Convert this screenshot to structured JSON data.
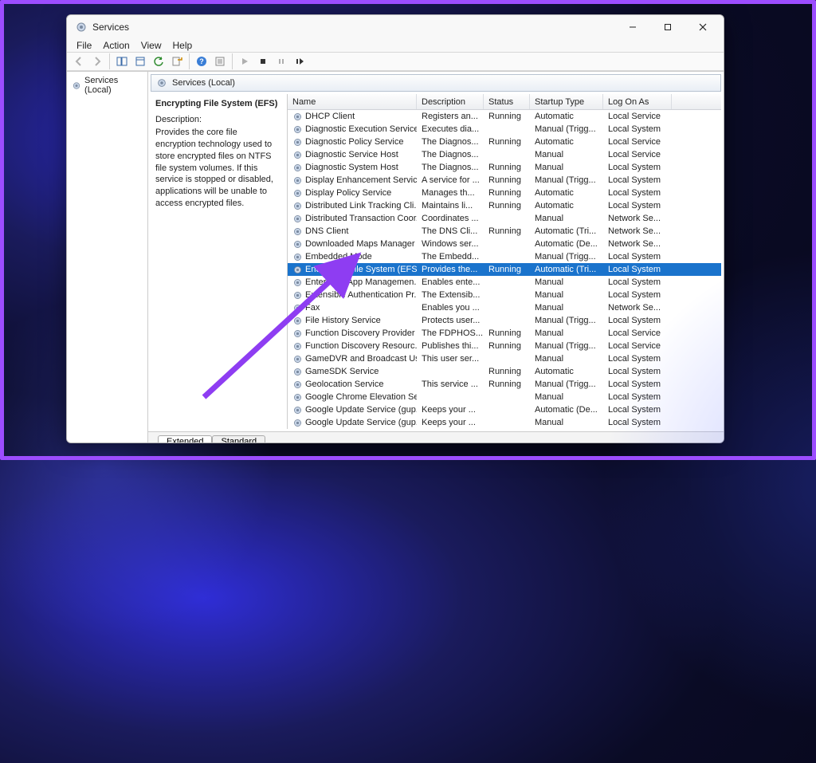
{
  "window": {
    "title": "Services"
  },
  "menu": [
    "File",
    "Action",
    "View",
    "Help"
  ],
  "tree_root": "Services (Local)",
  "header_label": "Services (Local)",
  "detail": {
    "name": "Encrypting File System (EFS)",
    "label": "Description:",
    "description": "Provides the core file encryption technology used to store encrypted files on NTFS file system volumes. If this service is stopped or disabled, applications will be unable to access encrypted files."
  },
  "columns": {
    "name": "Name",
    "description": "Description",
    "status": "Status",
    "startup": "Startup Type",
    "logon": "Log On As"
  },
  "services": [
    {
      "name": "DHCP Client",
      "desc": "Registers an...",
      "status": "Running",
      "startup": "Automatic",
      "logon": "Local Service"
    },
    {
      "name": "Diagnostic Execution Service",
      "desc": "Executes dia...",
      "status": "",
      "startup": "Manual (Trigg...",
      "logon": "Local System"
    },
    {
      "name": "Diagnostic Policy Service",
      "desc": "The Diagnos...",
      "status": "Running",
      "startup": "Automatic",
      "logon": "Local Service"
    },
    {
      "name": "Diagnostic Service Host",
      "desc": "The Diagnos...",
      "status": "",
      "startup": "Manual",
      "logon": "Local Service"
    },
    {
      "name": "Diagnostic System Host",
      "desc": "The Diagnos...",
      "status": "Running",
      "startup": "Manual",
      "logon": "Local System"
    },
    {
      "name": "Display Enhancement Service",
      "desc": "A service for ...",
      "status": "Running",
      "startup": "Manual (Trigg...",
      "logon": "Local System"
    },
    {
      "name": "Display Policy Service",
      "desc": "Manages th...",
      "status": "Running",
      "startup": "Automatic",
      "logon": "Local System"
    },
    {
      "name": "Distributed Link Tracking Cli...",
      "desc": "Maintains li...",
      "status": "Running",
      "startup": "Automatic",
      "logon": "Local System"
    },
    {
      "name": "Distributed Transaction Coor...",
      "desc": "Coordinates ...",
      "status": "",
      "startup": "Manual",
      "logon": "Network Se..."
    },
    {
      "name": "DNS Client",
      "desc": "The DNS Cli...",
      "status": "Running",
      "startup": "Automatic (Tri...",
      "logon": "Network Se..."
    },
    {
      "name": "Downloaded Maps Manager",
      "desc": "Windows ser...",
      "status": "",
      "startup": "Automatic (De...",
      "logon": "Network Se..."
    },
    {
      "name": "Embedded Mode",
      "desc": "The Embedd...",
      "status": "",
      "startup": "Manual (Trigg...",
      "logon": "Local System"
    },
    {
      "name": "Encrypting File System (EFS)",
      "desc": "Provides the...",
      "status": "Running",
      "startup": "Automatic (Tri...",
      "logon": "Local System",
      "selected": true
    },
    {
      "name": "Enterprise App Managemen...",
      "desc": "Enables ente...",
      "status": "",
      "startup": "Manual",
      "logon": "Local System"
    },
    {
      "name": "Extensible Authentication Pr...",
      "desc": "The Extensib...",
      "status": "",
      "startup": "Manual",
      "logon": "Local System"
    },
    {
      "name": "Fax",
      "desc": "Enables you ...",
      "status": "",
      "startup": "Manual",
      "logon": "Network Se..."
    },
    {
      "name": "File History Service",
      "desc": "Protects user...",
      "status": "",
      "startup": "Manual (Trigg...",
      "logon": "Local System"
    },
    {
      "name": "Function Discovery Provider ...",
      "desc": "The FDPHOS...",
      "status": "Running",
      "startup": "Manual",
      "logon": "Local Service"
    },
    {
      "name": "Function Discovery Resourc...",
      "desc": "Publishes thi...",
      "status": "Running",
      "startup": "Manual (Trigg...",
      "logon": "Local Service"
    },
    {
      "name": "GameDVR and Broadcast Us...",
      "desc": "This user ser...",
      "status": "",
      "startup": "Manual",
      "logon": "Local System"
    },
    {
      "name": "GameSDK Service",
      "desc": "",
      "status": "Running",
      "startup": "Automatic",
      "logon": "Local System"
    },
    {
      "name": "Geolocation Service",
      "desc": "This service ...",
      "status": "Running",
      "startup": "Manual (Trigg...",
      "logon": "Local System"
    },
    {
      "name": "Google Chrome Elevation Se...",
      "desc": "",
      "status": "",
      "startup": "Manual",
      "logon": "Local System"
    },
    {
      "name": "Google Update Service (gup...",
      "desc": "Keeps your ...",
      "status": "",
      "startup": "Automatic (De...",
      "logon": "Local System"
    },
    {
      "name": "Google Update Service (gup...",
      "desc": "Keeps your ...",
      "status": "",
      "startup": "Manual",
      "logon": "Local System"
    }
  ],
  "tabs": {
    "extended": "Extended",
    "standard": "Standard"
  }
}
